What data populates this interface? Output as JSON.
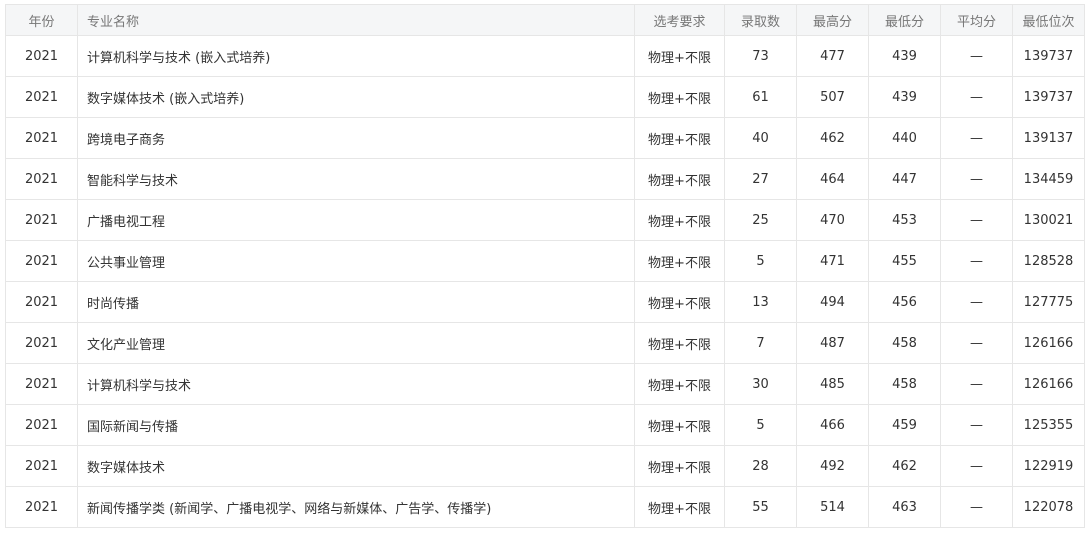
{
  "headers": [
    "年份",
    "专业名称",
    "选考要求",
    "录取数",
    "最高分",
    "最低分",
    "平均分",
    "最低位次"
  ],
  "rows": [
    [
      "2021",
      "计算机科学与技术 (嵌入式培养)",
      "物理+不限",
      "73",
      "477",
      "439",
      "—",
      "139737"
    ],
    [
      "2021",
      "数字媒体技术 (嵌入式培养)",
      "物理+不限",
      "61",
      "507",
      "439",
      "—",
      "139737"
    ],
    [
      "2021",
      "跨境电子商务",
      "物理+不限",
      "40",
      "462",
      "440",
      "—",
      "139137"
    ],
    [
      "2021",
      "智能科学与技术",
      "物理+不限",
      "27",
      "464",
      "447",
      "—",
      "134459"
    ],
    [
      "2021",
      "广播电视工程",
      "物理+不限",
      "25",
      "470",
      "453",
      "—",
      "130021"
    ],
    [
      "2021",
      "公共事业管理",
      "物理+不限",
      "5",
      "471",
      "455",
      "—",
      "128528"
    ],
    [
      "2021",
      "时尚传播",
      "物理+不限",
      "13",
      "494",
      "456",
      "—",
      "127775"
    ],
    [
      "2021",
      "文化产业管理",
      "物理+不限",
      "7",
      "487",
      "458",
      "—",
      "126166"
    ],
    [
      "2021",
      "计算机科学与技术",
      "物理+不限",
      "30",
      "485",
      "458",
      "—",
      "126166"
    ],
    [
      "2021",
      "国际新闻与传播",
      "物理+不限",
      "5",
      "466",
      "459",
      "—",
      "125355"
    ],
    [
      "2021",
      "数字媒体技术",
      "物理+不限",
      "28",
      "492",
      "462",
      "—",
      "122919"
    ],
    [
      "2021",
      "新闻传播学类 (新闻学、广播电视学、网络与新媒体、广告学、传播学)",
      "物理+不限",
      "55",
      "514",
      "463",
      "—",
      "122078"
    ]
  ]
}
